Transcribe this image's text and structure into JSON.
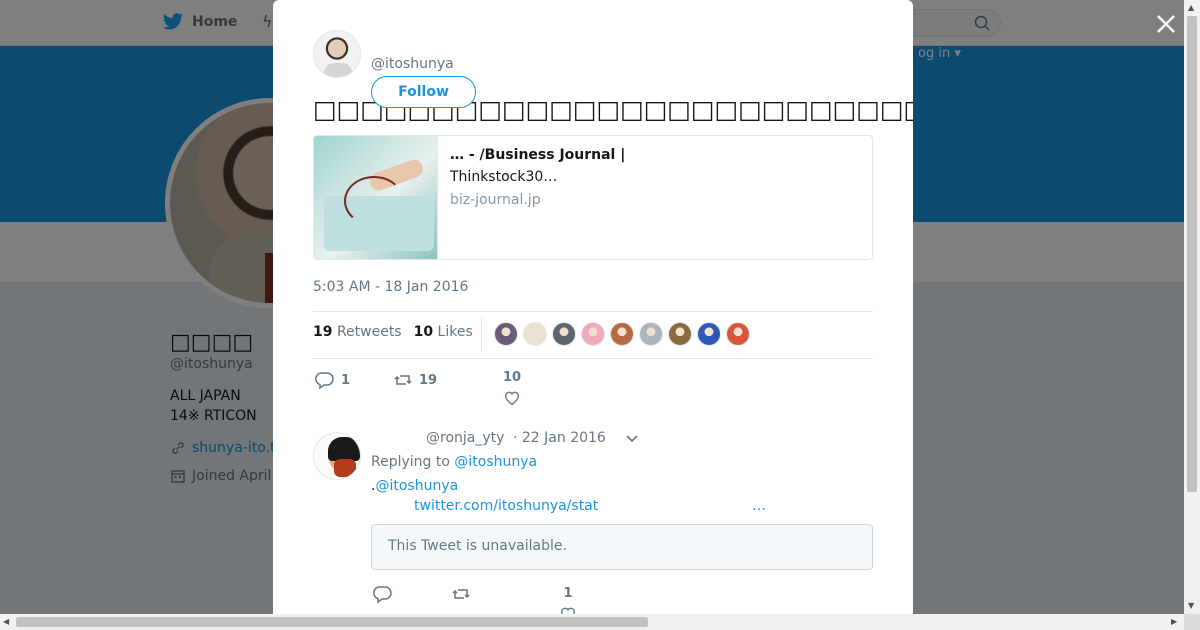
{
  "topbar": {
    "home_label": "Home",
    "login_label": "og in ▾"
  },
  "profile": {
    "name": "□□□□",
    "handle": "@itoshunya",
    "bio_line1": "ALL JAPAN",
    "bio_line2": "14※ RTICON",
    "link": "shunya-ito.t",
    "joined": "Joined April"
  },
  "tweet": {
    "author_handle": "@itoshunya",
    "follow_label": "Follow",
    "text": "□□□□□□□□□□□□□□□□□□□□□□□□□□□□□□□□□□□□□□□□□□□□□□□□□□□□□□□□□□→□",
    "card": {
      "title": "… - /Business Journal |",
      "description": "Thinkstock30…",
      "domain": "biz-journal.jp"
    },
    "timestamp": "5:03 AM - 18 Jan 2016",
    "retweets_count": "19",
    "retweets_label": "Retweets",
    "likes_count": "10",
    "likes_label": "Likes",
    "liker_colors": [
      "#6b5a78",
      "#e9e2d0",
      "#5d6670",
      "#f2a9b8",
      "#b8693e",
      "#aab4bd",
      "#8a6a3a",
      "#2e58b8",
      "#d9563b"
    ],
    "actions": {
      "reply_count": "1",
      "retweet_count": "19",
      "like_count": "10"
    }
  },
  "reply": {
    "handle": "@ronja_yty",
    "date": "· 22 Jan 2016",
    "replying_to_label": "Replying to",
    "replying_to_handle": "@itoshunya",
    "text_prefix": ".",
    "mention": "@itoshunya",
    "link": "twitter.com/itoshunya/stat",
    "ellipsis": "…",
    "unavailable": "This Tweet is unavailable.",
    "like_count": "1"
  }
}
